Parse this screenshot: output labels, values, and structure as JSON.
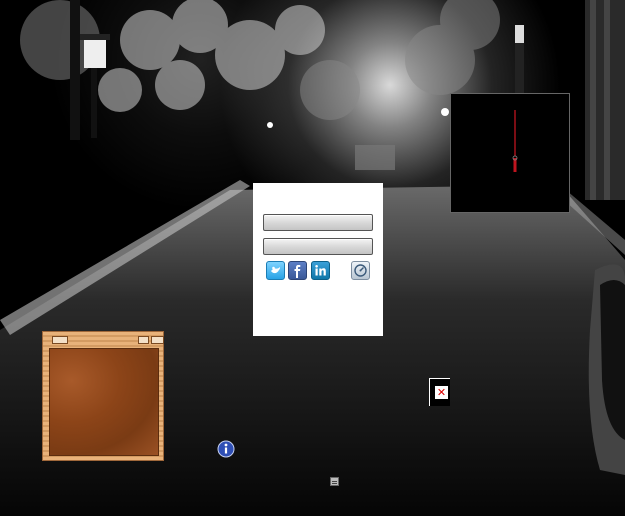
{
  "desktop": {
    "wallpaper_description": "",
    "widgets": {
      "login": {
        "username_value": "",
        "password_value": "",
        "social_icons": [
          "twitter-icon",
          "facebook-icon",
          "linkedin-icon",
          "speedometer-icon"
        ]
      },
      "clock": {},
      "notes": {
        "content": ""
      }
    },
    "icons": {
      "info": "info-icon",
      "broken_image": "broken-image-icon",
      "tray": "tray-icon"
    }
  },
  "colors": {
    "clock_hand": "#c0141e",
    "twitter": "#2aa3e6",
    "facebook": "#3b5998",
    "linkedin": "#0e76a8",
    "wood": "#8c4418"
  }
}
